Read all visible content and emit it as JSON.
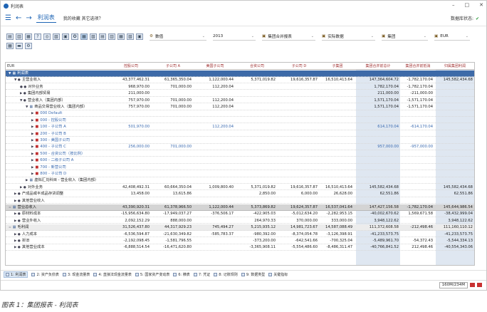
{
  "window": {
    "title": "利润表",
    "minimize": "–",
    "maximize": "□",
    "close": "✕"
  },
  "nav": {
    "tab_title": "利润表",
    "favorites": "我的收藏 其它选项？",
    "status_label": "数据库状态:",
    "status_mark": "✔"
  },
  "toolbar": {
    "row2_icons": [
      "▦",
      "▬",
      "⚙"
    ],
    "row1_icons": [
      "▤",
      "▥",
      "▦",
      "?",
      "◎",
      "▧",
      "▣",
      "✪",
      "▦",
      "▧",
      "▤",
      "▥",
      "▦",
      "▧",
      "▣"
    ],
    "dropdowns": [
      {
        "icon": "⚙",
        "value": "数值"
      },
      {
        "icon": "",
        "value": "2013"
      },
      {
        "icon": "▣",
        "value": "集团合并报表"
      },
      {
        "icon": "▣",
        "value": "实际数据"
      },
      {
        "icon": "▣",
        "value": "集团"
      },
      {
        "icon": "▣",
        "value": "EUR"
      }
    ]
  },
  "grid": {
    "corner": "EUR",
    "columns": [
      "控股公司",
      "子公司 A",
      "美国子公司",
      "合资公司",
      "子公司 D",
      "子集团",
      "集团合并前总计",
      "集团合并前抵消",
      "归属集团利润"
    ],
    "rows": [
      {
        "label": "利润表",
        "toggle": "▼",
        "box": "▦",
        "indent": 0,
        "style": "head",
        "values": [
          "",
          "",
          "",
          "",
          "",
          "",
          "",
          "",
          ""
        ]
      },
      {
        "label": "主营业收入",
        "toggle": "▼ ●",
        "indent": 1,
        "values": [
          "43,377,462.31",
          "61,365,350.04",
          "1,122,000.44",
          "5,371,019.82",
          "19,616,357.87",
          "16,510,413.64",
          "147,364,604.72",
          "-1,782,170.04",
          "145,582,434.68"
        ]
      },
      {
        "label": "对外业务",
        "toggle": "● ●",
        "indent": 2,
        "values": [
          "968,970.00",
          "701,000.00",
          "112,200.04",
          "",
          "",
          "",
          "1,782,170.04",
          "-1,782,170.04",
          ""
        ]
      },
      {
        "label": "集团内部贸易",
        "toggle": "▶ ●",
        "indent": 2,
        "values": [
          "211,000.00",
          "",
          "",
          "",
          "",
          "",
          "211,000.00",
          "-211,000.00",
          ""
        ]
      },
      {
        "label": "营业收入（集团内部）",
        "toggle": "▼ ●",
        "indent": 2,
        "values": [
          "757,970.00",
          "701,000.00",
          "112,200.04",
          "",
          "",
          "",
          "1,571,170.04",
          "-1,571,170.04",
          ""
        ]
      },
      {
        "label": "商品交易营业收入（集团内部）",
        "toggle": "▼",
        "box": "▦",
        "indent": 3,
        "values": [
          "757,970.00",
          "701,000.00",
          "112,200.04",
          "",
          "",
          "",
          "1,571,170.04",
          "-1,571,170.04",
          ""
        ]
      },
      {
        "label": "000 Default",
        "toggle": "▶",
        "box": "■",
        "indent": 4,
        "link": true,
        "values": [
          "",
          "",
          "",
          "",
          "",
          "",
          "",
          "",
          ""
        ]
      },
      {
        "label": "000 - 控股公司",
        "toggle": "▶",
        "box": "■",
        "indent": 4,
        "link": true,
        "values": [
          "",
          "",
          "",
          "",
          "",
          "",
          "",
          "",
          ""
        ]
      },
      {
        "label": "100 - 子公司 A",
        "toggle": "▶",
        "box": "■",
        "indent": 4,
        "link": true,
        "values": [
          "501,970.00",
          "",
          "112,200.04",
          "",
          "",
          "",
          "614,170.04",
          "-614,170.04",
          ""
        ]
      },
      {
        "label": "200 - 子公司 B",
        "toggle": "▶",
        "box": "■",
        "indent": 4,
        "link": true,
        "values": [
          "",
          "",
          "",
          "",
          "",
          "",
          "",
          "",
          ""
        ]
      },
      {
        "label": "300 - 美国子公司",
        "toggle": "▶",
        "box": "■",
        "indent": 4,
        "link": true,
        "values": [
          "",
          "",
          "",
          "",
          "",
          "",
          "",
          "",
          ""
        ]
      },
      {
        "label": "400 - 子公司 C",
        "toggle": "▶",
        "box": "■",
        "indent": 4,
        "link": true,
        "values": [
          "256,000.00",
          "701,000.00",
          "",
          "",
          "",
          "",
          "957,000.00",
          "-957,000.00",
          ""
        ]
      },
      {
        "label": "500 - 合资公司（按比例）",
        "toggle": "▶",
        "box": "■",
        "indent": 4,
        "link": true,
        "values": [
          "",
          "",
          "",
          "",
          "",
          "",
          "",
          "",
          ""
        ]
      },
      {
        "label": "600 - 二级子公司 A",
        "toggle": "▶",
        "box": "■",
        "indent": 4,
        "link": true,
        "values": [
          "",
          "",
          "",
          "",
          "",
          "",
          "",
          "",
          ""
        ]
      },
      {
        "label": "700 - 新营公司",
        "toggle": "▶",
        "box": "■",
        "indent": 4,
        "link": true,
        "values": [
          "",
          "",
          "",
          "",
          "",
          "",
          "",
          "",
          ""
        ]
      },
      {
        "label": "800 - 子公司 D",
        "toggle": "▶",
        "box": "■",
        "indent": 4,
        "link": true,
        "values": [
          "",
          "",
          "",
          "",
          "",
          "",
          "",
          "",
          ""
        ]
      },
      {
        "label": "虚拟汇兑科目 - 营业收入（集团内部）",
        "toggle": "▶",
        "box": "▦",
        "indent": 3,
        "values": [
          "",
          "",
          "",
          "",
          "",
          "",
          "",
          "",
          ""
        ]
      },
      {
        "label": "对外业务",
        "toggle": "▶ ●",
        "indent": 2,
        "values": [
          "42,408,492.31",
          "60,664,350.04",
          "1,009,800.40",
          "5,371,019.82",
          "19,616,357.87",
          "16,510,413.64",
          "145,582,434.68",
          "",
          "145,582,434.68"
        ]
      },
      {
        "label": "产成品或半成品存货调整",
        "toggle": "▶ ●",
        "indent": 1,
        "values": [
          "13,458.00",
          "13,615.86",
          "",
          "2,850.00",
          "6,000.00",
          "26,628.00",
          "62,551.86",
          "",
          "62,551.86"
        ]
      },
      {
        "label": "其他营业收入",
        "toggle": "▶ ●",
        "indent": 1,
        "values": [
          "",
          "",
          "",
          "",
          "",
          "",
          "",
          "",
          ""
        ]
      },
      {
        "label": "营业总收入",
        "toggle": "=",
        "box": "▦",
        "indent": 0,
        "style": "sep",
        "values": [
          "43,390,920.31",
          "61,378,966.50",
          "1,122,000.44",
          "5,373,869.82",
          "19,624,357.87",
          "16,537,041.64",
          "147,427,156.58",
          "-1,782,170.04",
          "145,644,986.54"
        ]
      },
      {
        "label": "原材料成本",
        "toggle": "▶ ●",
        "indent": 1,
        "values": [
          "-15,956,634.80",
          "-17,949,037.27",
          "-376,506.17",
          "-422,905.03",
          "-5,012,634.20",
          "-2,282,953.15",
          "-40,002,670.62",
          "1,569,671.58",
          "-38,432,999.04"
        ]
      },
      {
        "label": "营业外收入",
        "toggle": "▶ ●",
        "indent": 1,
        "values": [
          "2,092,152.29",
          "888,000.00",
          "",
          "264,970.33",
          "370,000.00",
          "333,000.00",
          "3,948,122.62",
          "",
          "3,948,122.62"
        ]
      },
      {
        "label": "毛利润",
        "toggle": "=",
        "box": "▦",
        "indent": 0,
        "style": "gray",
        "values": [
          "31,526,437.80",
          "44,317,929.23",
          "745,494.27",
          "5,215,935.12",
          "14,981,723.67",
          "14,587,088.49",
          "111,372,608.58",
          "-212,498.46",
          "111,160,110.12"
        ]
      },
      {
        "label": "人力成本",
        "toggle": "▶ ●",
        "indent": 1,
        "values": [
          "-6,536,594.87",
          "-21,630,349.82",
          "-585,783.37",
          "-980,392.00",
          "-8,374,054.78",
          "-3,126,398.91",
          "-41,233,573.75",
          "",
          "-41,233,573.75"
        ]
      },
      {
        "label": "折旧",
        "toggle": "▶ ●",
        "indent": 1,
        "values": [
          "-2,192,098.45",
          "-1,581,796.55",
          "",
          "-373,200.00",
          "-642,541.66",
          "-700,325.04",
          "-5,489,961.70",
          "-54,372.43",
          "-5,544,334.13"
        ]
      },
      {
        "label": "其他营业成本",
        "toggle": "▶ ●",
        "indent": 1,
        "values": [
          "-6,888,514.54",
          "-16,471,620.80",
          "",
          "-3,365,908.11",
          "-5,554,486.60",
          "-8,486,311.47",
          "-40,766,841.52",
          "212,498.46",
          "-40,554,343.06"
        ]
      }
    ]
  },
  "status_tabs": [
    {
      "label": "1: 利润表",
      "active": true
    },
    {
      "label": "2: 资产负债表"
    },
    {
      "label": "3: 现金流量表"
    },
    {
      "label": "4: 直接法现金流量表"
    },
    {
      "label": "5: 国家资产变动表"
    },
    {
      "label": "6: 横表"
    },
    {
      "label": "7: 凭证"
    },
    {
      "label": "8: 记账规则"
    },
    {
      "label": "9: 数据类型"
    },
    {
      "label": "关键指标"
    }
  ],
  "memory": "160M/234M",
  "caption": "图表 1：集团报表 - 利润表"
}
